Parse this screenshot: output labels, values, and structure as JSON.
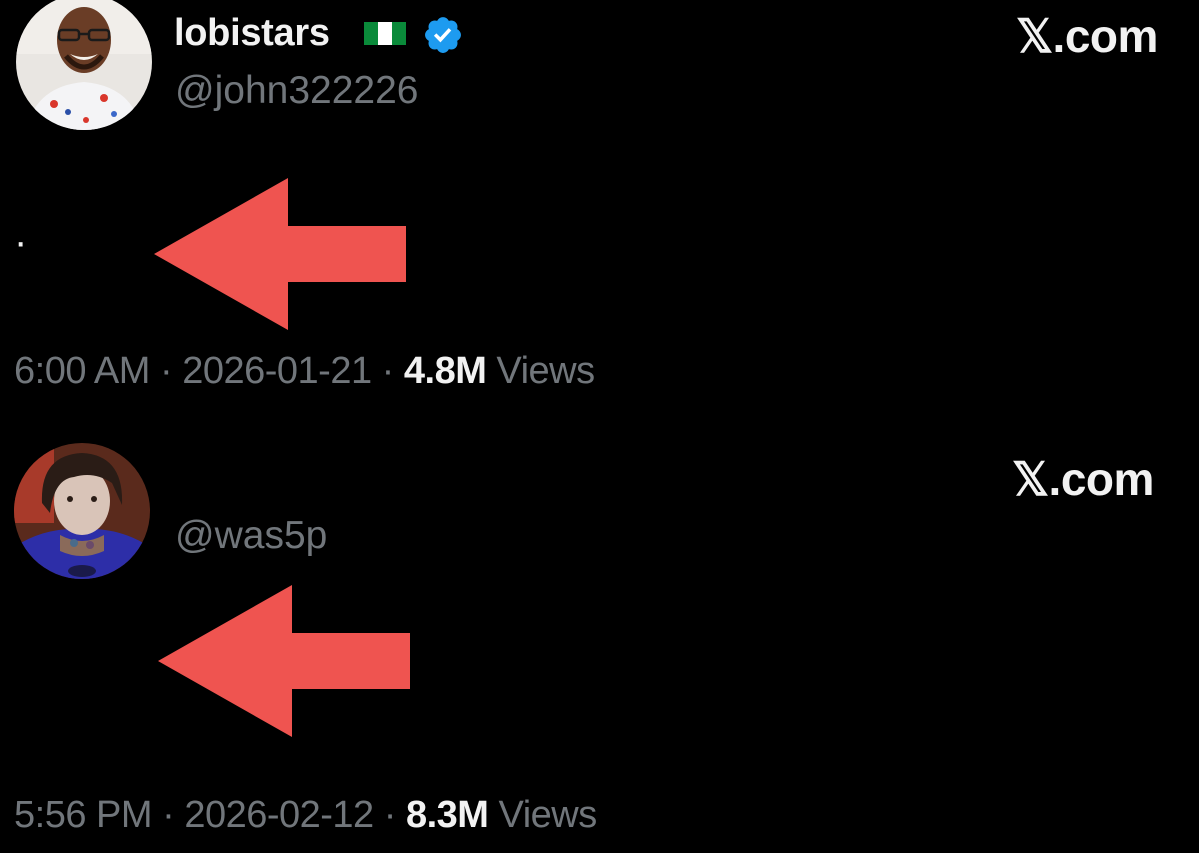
{
  "tweets": [
    {
      "display_name": "lobistars",
      "flag_emoji": "🇳🇬",
      "verified": true,
      "verified_color": "#1d9bf0",
      "handle": "@john322226",
      "site_logo": "𝕏.com",
      "body_text": "·",
      "time": "6:00 AM",
      "date": "2026-01-21",
      "views_count": "4.8M",
      "views_label": "Views",
      "separator": "·"
    },
    {
      "display_name": "",
      "handle": "@was5p",
      "site_logo": "𝕏.com",
      "body_text": "",
      "time": "5:56 PM",
      "date": "2026-02-12",
      "views_count": "8.3M",
      "views_label": "Views",
      "separator": "·"
    }
  ],
  "colors": {
    "background": "#000000",
    "primary_text": "#f2f2f2",
    "secondary_text": "#71767b",
    "arrow": "#ef5450"
  },
  "icons": {
    "arrow": "red-left-arrow-icon",
    "verified": "verified-badge-icon",
    "flag": "nigeria-flag-icon"
  }
}
